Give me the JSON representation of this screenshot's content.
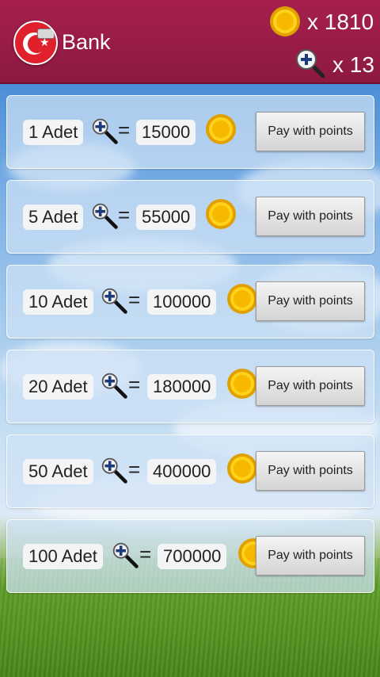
{
  "header": {
    "title": "Bank",
    "coin_balance": "x 1810",
    "magnifier_balance": "x 13"
  },
  "offers": [
    {
      "amount": "1 Adet",
      "equals": "=",
      "price": "15000",
      "button": "Pay with points"
    },
    {
      "amount": "5 Adet",
      "equals": "=",
      "price": "55000",
      "button": "Pay with points"
    },
    {
      "amount": "10 Adet",
      "equals": "=",
      "price": "100000",
      "button": "Pay with points"
    },
    {
      "amount": "20 Adet",
      "equals": "=",
      "price": "180000",
      "button": "Pay with points"
    },
    {
      "amount": "50 Adet",
      "equals": "=",
      "price": "400000",
      "button": "Pay with points"
    },
    {
      "amount": "100 Adet",
      "equals": "=",
      "price": "700000",
      "button": "Pay with points"
    }
  ],
  "colors": {
    "header_bg": "#9b1d47",
    "coin_gold": "#f5b800",
    "button_bg": "#e4e4e4"
  },
  "icons": {
    "flag": "turkey-flag-icon",
    "coin": "gold-coin-icon",
    "magnifier": "magnifier-plus-icon"
  }
}
